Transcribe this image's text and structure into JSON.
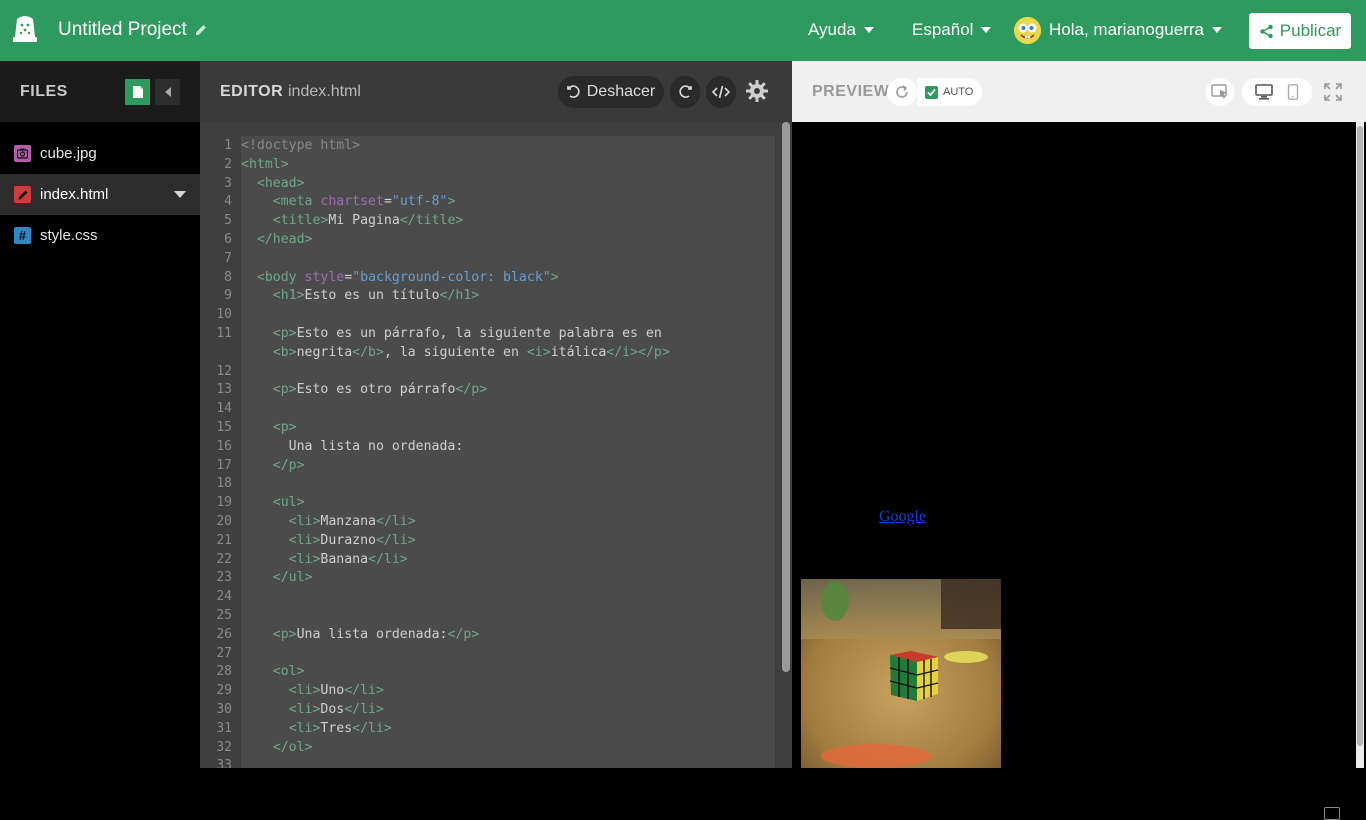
{
  "topbar": {
    "project_title": "Untitled Project",
    "help_label": "Ayuda",
    "language_label": "Español",
    "greeting": "Hola, marianoguerra",
    "publish_label": "Publicar"
  },
  "files": {
    "title": "FILES",
    "items": [
      {
        "label": "cube.jpg",
        "icon": "image-icon",
        "color": "#b05fa8"
      },
      {
        "label": "index.html",
        "icon": "html-pencil-icon",
        "color": "#d23b3b"
      },
      {
        "label": "style.css",
        "icon": "hash-icon",
        "color": "#2f86c6"
      }
    ]
  },
  "editor": {
    "title": "EDITOR",
    "filename": "index.html",
    "undo_label": "Deshacer",
    "line_numbers": [
      "1",
      "2",
      "3",
      "4",
      "5",
      "6",
      "7",
      "8",
      "9",
      "10",
      "11",
      "",
      "12",
      "13",
      "14",
      "15",
      "16",
      "17",
      "18",
      "19",
      "20",
      "21",
      "22",
      "23",
      "24",
      "25",
      "26",
      "27",
      "28",
      "29",
      "30",
      "31",
      "32",
      "33"
    ]
  },
  "preview": {
    "title": "PREVIEW",
    "auto_label": "AUTO",
    "link_text": "Google"
  },
  "colors": {
    "brand": "#2f9a5e",
    "editor_bg": "#3f3f3f",
    "tag": "#6fa68a",
    "attr": "#9c6cae",
    "string": "#6b9ecf"
  }
}
